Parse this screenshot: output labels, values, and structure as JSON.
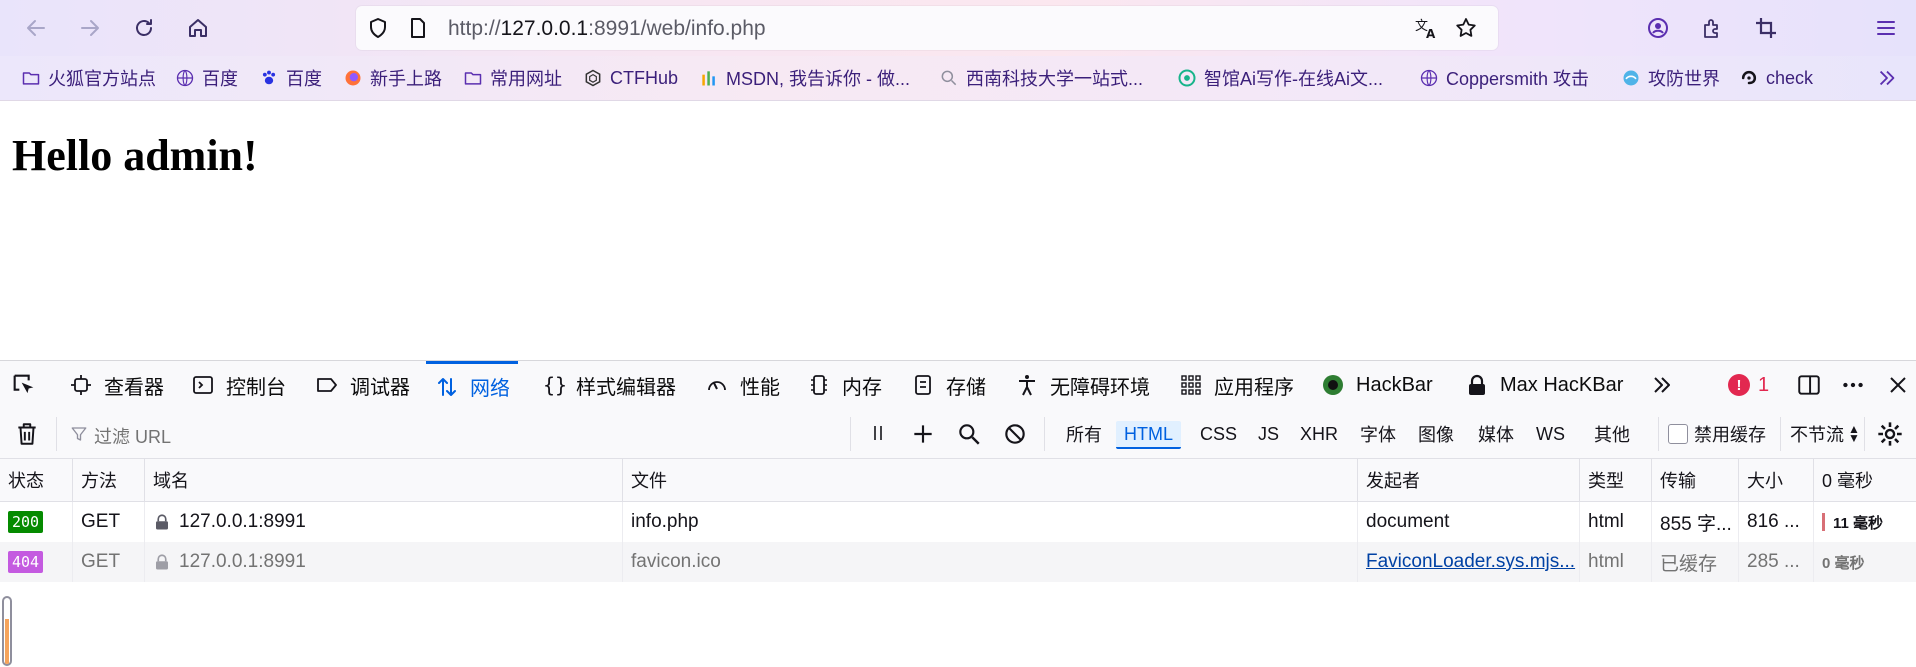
{
  "browser": {
    "url_prefix": "http://",
    "url_host": "127.0.0.1",
    "url_rest": ":8991/web/info.php",
    "icons": [
      "back-arrow-icon",
      "forward-arrow-icon",
      "reload-icon",
      "home-icon",
      "shield-icon",
      "page-icon",
      "translate-icon",
      "star-icon",
      "account-icon",
      "extensions-icon",
      "crop-icon",
      "menu-icon"
    ]
  },
  "bookmarks": [
    {
      "label": "火狐官方站点",
      "icon": "folder-icon"
    },
    {
      "label": "百度",
      "icon": "globe-icon"
    },
    {
      "label": "百度",
      "icon": "baidu-paw-icon"
    },
    {
      "label": "新手上路",
      "icon": "firefox-icon"
    },
    {
      "label": "常用网址",
      "icon": "folder-icon"
    },
    {
      "label": "CTFHub",
      "icon": "ctfhub-icon"
    },
    {
      "label": "MSDN, 我告诉你 - 做...",
      "icon": "msdn-icon"
    },
    {
      "label": "西南科技大学一站式...",
      "icon": "search-icon"
    },
    {
      "label": "智馆Ai写作-在线Ai文...",
      "icon": "ai-icon"
    },
    {
      "label": "Coppersmith 攻击",
      "icon": "globe-icon"
    },
    {
      "label": "攻防世界",
      "icon": "adworld-icon"
    },
    {
      "label": "check",
      "icon": "check-icon"
    }
  ],
  "page": {
    "heading": "Hello admin!"
  },
  "devtools": {
    "tabs": [
      {
        "label": "查看器"
      },
      {
        "label": "控制台"
      },
      {
        "label": "调试器"
      },
      {
        "label": "网络"
      },
      {
        "label": "样式编辑器"
      },
      {
        "label": "性能"
      },
      {
        "label": "内存"
      },
      {
        "label": "存储"
      },
      {
        "label": "无障碍环境"
      },
      {
        "label": "应用程序"
      },
      {
        "label": "HackBar"
      },
      {
        "label": "Max HacKBar"
      }
    ],
    "active_tab": "网络",
    "error_count": "1",
    "filter_placeholder": "过滤 URL",
    "type_filters": [
      "所有",
      "HTML",
      "CSS",
      "JS",
      "XHR",
      "字体",
      "图像",
      "媒体",
      "WS",
      "其他"
    ],
    "active_type_filter": "HTML",
    "disable_cache_label": "禁用缓存",
    "throttle_label": "不节流",
    "columns": [
      "状态",
      "方法",
      "域名",
      "文件",
      "发起者",
      "类型",
      "传输",
      "大小",
      "0 毫秒"
    ],
    "requests": [
      {
        "status": "200",
        "status_color": "#058b00",
        "method": "GET",
        "domain": "127.0.0.1:8991",
        "file": "info.php",
        "initiator": "document",
        "type": "html",
        "transferred": "855 字...",
        "size": "816 ...",
        "time": "11 毫秒"
      },
      {
        "status": "404",
        "status_color": "#c45ae0",
        "method": "GET",
        "domain": "127.0.0.1:8991",
        "file": "favicon.ico",
        "initiator": "FaviconLoader.sys.mjs...",
        "type": "html",
        "transferred": "已缓存",
        "size": "285 ...",
        "time": "0 毫秒"
      }
    ]
  }
}
